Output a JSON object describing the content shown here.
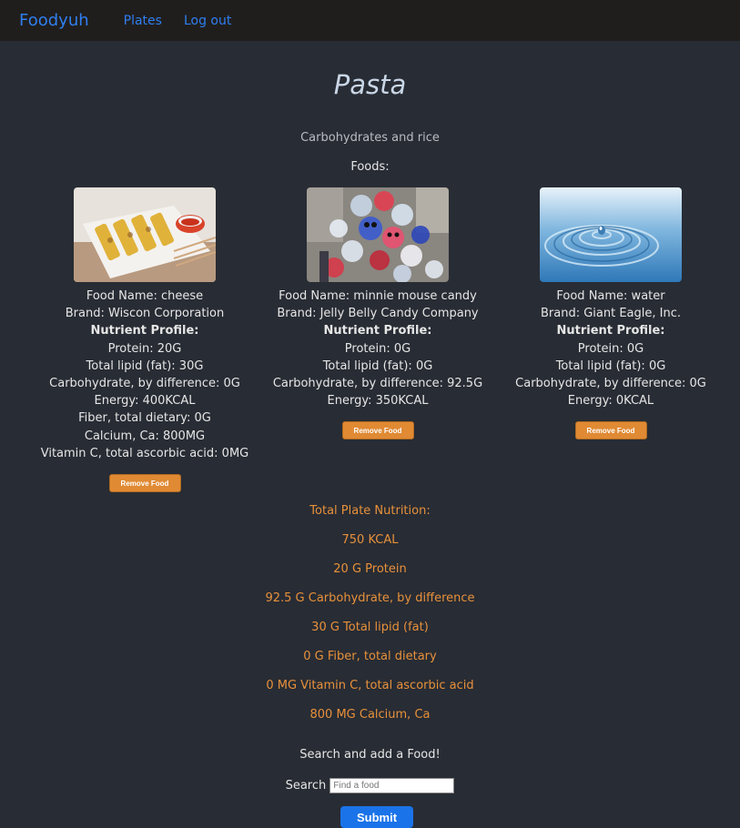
{
  "nav": {
    "brand": "Foodyuh",
    "links": [
      "Plates",
      "Log out"
    ]
  },
  "plate": {
    "title": "Pasta",
    "description": "Carbohydrates and rice",
    "foods_label": "Foods:"
  },
  "foods": [
    {
      "name": "Food Name: cheese",
      "brand": "Brand: Wiscon Corporation",
      "nutrient_label": "Nutrient Profile:",
      "nutrients": [
        "Protein: 20G",
        "Total lipid (fat): 30G",
        "Carbohydrate, by difference: 0G",
        "Energy: 400KCAL",
        "Fiber, total dietary: 0G",
        "Calcium, Ca: 800MG",
        "Vitamin C, total ascorbic acid: 0MG"
      ],
      "remove_label": "Remove Food"
    },
    {
      "name": "Food Name: minnie mouse candy",
      "brand": "Brand: Jelly Belly Candy Company",
      "nutrient_label": "Nutrient Profile:",
      "nutrients": [
        "Protein: 0G",
        "Total lipid (fat): 0G",
        "Carbohydrate, by difference: 92.5G",
        "Energy: 350KCAL"
      ],
      "remove_label": "Remove Food"
    },
    {
      "name": "Food Name: water",
      "brand": "Brand: Giant Eagle, Inc.",
      "nutrient_label": "Nutrient Profile:",
      "nutrients": [
        "Protein: 0G",
        "Total lipid (fat): 0G",
        "Carbohydrate, by difference: 0G",
        "Energy: 0KCAL"
      ],
      "remove_label": "Remove Food"
    }
  ],
  "totals": {
    "heading": "Total Plate Nutrition:",
    "items": [
      "750 KCAL",
      "20 G Protein",
      "92.5 G Carbohydrate, by difference",
      "30 G Total lipid (fat)",
      "0 G Fiber, total dietary",
      "0 MG Vitamin C, total ascorbic acid",
      "800 MG Calcium, Ca"
    ]
  },
  "search": {
    "title": "Search and add a Food!",
    "label": "Search",
    "placeholder": "Find a food",
    "submit_label": "Submit"
  },
  "colors": {
    "background": "#282c34",
    "navbar": "#201e1d",
    "link": "#2f7ff0",
    "accent": "#e8913b",
    "submit": "#1a73e8"
  }
}
